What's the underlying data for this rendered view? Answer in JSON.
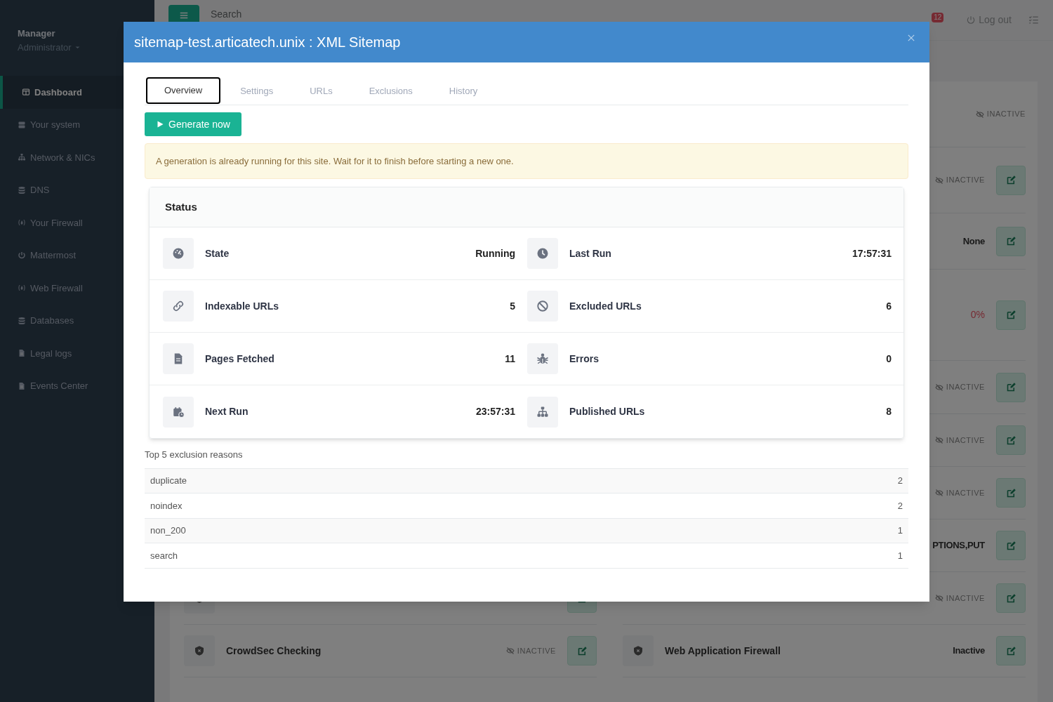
{
  "sidebar": {
    "user": "Manager",
    "role": "Administrator",
    "items": [
      {
        "label": "Dashboard",
        "selected": true
      },
      {
        "label": "Your system",
        "selected": false
      },
      {
        "label": "Network & NICs",
        "selected": false
      },
      {
        "label": "DNS",
        "selected": false
      },
      {
        "label": "Your Firewall",
        "selected": false
      },
      {
        "label": "Mattermost",
        "selected": false
      },
      {
        "label": "Web Firewall",
        "selected": false
      },
      {
        "label": "Databases",
        "selected": false
      },
      {
        "label": "Legal logs",
        "selected": false
      },
      {
        "label": "Events Center",
        "selected": false
      }
    ]
  },
  "topbar": {
    "search_placeholder": "Search",
    "notifications": "12",
    "logout": "Log out"
  },
  "background_panel": {
    "right_rows": [
      {
        "kind": "inactive",
        "value": "INACTIVE",
        "edit": false
      },
      {
        "kind": "inactive",
        "value": "INACTIVE",
        "edit": true
      },
      {
        "kind": "text",
        "value": "None",
        "edit": true
      },
      {
        "kind": "percent",
        "value": "0%",
        "edit": true
      },
      {
        "kind": "inactive",
        "value": "INACTIVE",
        "edit": true
      },
      {
        "kind": "inactive",
        "value": "INACTIVE",
        "edit": true
      },
      {
        "kind": "inactive",
        "value": "INACTIVE",
        "edit": true
      },
      {
        "kind": "text",
        "value": "PTIONS,PUT",
        "edit": true
      },
      {
        "kind": "inactive",
        "value": "INACTIVE",
        "edit": true
      },
      {
        "kind": "text",
        "value": "Inactive",
        "edit": true
      }
    ],
    "left_rows": [
      {
        "label": "CrowdSec Checking",
        "kind": "inactive",
        "value": "INACTIVE",
        "edit": true
      }
    ],
    "right_labels": [
      "Web Application Firewall"
    ]
  },
  "modal": {
    "title": "sitemap-test.articatech.unix : XML Sitemap",
    "tabs": [
      {
        "label": "Overview",
        "selected": true
      },
      {
        "label": "Settings",
        "selected": false
      },
      {
        "label": "URLs",
        "selected": false
      },
      {
        "label": "Exclusions",
        "selected": false
      },
      {
        "label": "History",
        "selected": false
      }
    ],
    "generate_button": "Generate now",
    "alert": "A generation is already running for this site. Wait for it to finish before starting a new one.",
    "status": {
      "title": "Status",
      "stats": [
        {
          "label": "State",
          "value": "Running"
        },
        {
          "label": "Last Run",
          "value": "17:57:31"
        },
        {
          "label": "Indexable URLs",
          "value": "5"
        },
        {
          "label": "Excluded URLs",
          "value": "6"
        },
        {
          "label": "Pages Fetched",
          "value": "11"
        },
        {
          "label": "Errors",
          "value": "0"
        },
        {
          "label": "Next Run",
          "value": "23:57:31"
        },
        {
          "label": "Published URLs",
          "value": "8"
        }
      ]
    },
    "exclusions": {
      "title": "Top 5 exclusion reasons",
      "rows": [
        {
          "reason": "duplicate",
          "count": "2"
        },
        {
          "reason": "noindex",
          "count": "2"
        },
        {
          "reason": "non_200",
          "count": "1"
        },
        {
          "reason": "search",
          "count": "1"
        }
      ]
    }
  }
}
